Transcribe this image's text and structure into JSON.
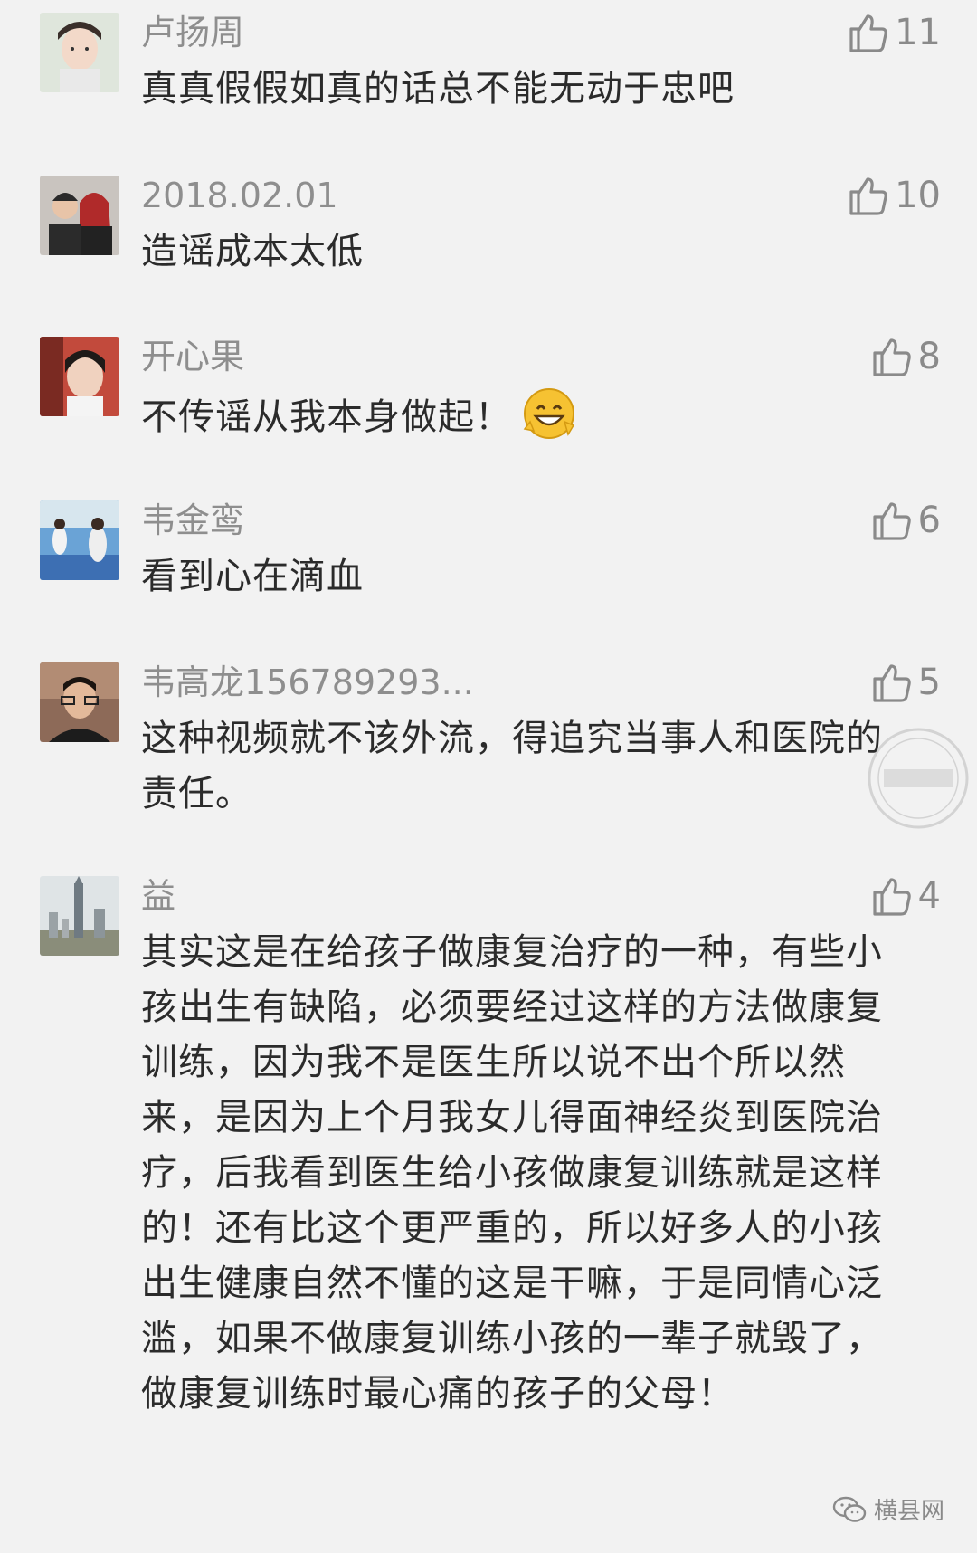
{
  "comments": [
    {
      "name": "卢扬周",
      "text": "真真假假如真的话总不能无动于忠吧",
      "likes": "11"
    },
    {
      "name": "2018.02.01",
      "text": "造谣成本太低",
      "likes": "10"
    },
    {
      "name": "开心果",
      "text": "不传谣从我本身做起！",
      "likes": "8"
    },
    {
      "name": "韦金鸾",
      "text": "看到心在滴血",
      "likes": "6"
    },
    {
      "name": "韦高龙156789293...",
      "text": "这种视频就不该外流，得追究当事人和医院的责任。",
      "likes": "5"
    },
    {
      "name": "益",
      "text": "其实这是在给孩子做康复治疗的一种，有些小孩出生有缺陷，必须要经过这样的方法做康复训练，因为我不是医生所以说不出个所以然来，是因为上个月我女儿得面神经炎到医院治疗，后我看到医生给小孩做康复训练就是这样的！还有比这个更严重的，所以好多人的小孩出生健康自然不懂的这是干嘛，于是同情心泛滥，如果不做康复训练小孩的一辈子就毁了，做康复训练时最心痛的孩子的父母！",
      "likes": "4"
    }
  ],
  "watermark": {
    "label": "横县网"
  },
  "icons": {
    "like": "thumbs-up-icon",
    "emoji": "grinning-emoji-icon",
    "footer": "wechat-icon"
  }
}
